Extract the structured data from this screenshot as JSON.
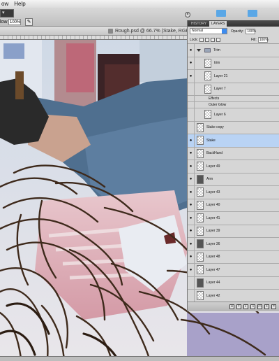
{
  "menubar": {
    "items": [
      "ow",
      "Help"
    ]
  },
  "options": {
    "flow_label": "low",
    "flow_value": "100%",
    "tool_preset": ""
  },
  "document": {
    "title": "Rough.psd @ 66.7% (Stake, RGB/8)"
  },
  "panel": {
    "tabs": [
      "HISTORY",
      "LAYERS"
    ],
    "blend_mode": "Normal",
    "opacity_label": "Opacity:",
    "opacity_value": "100%",
    "lock_label": "Lock:",
    "fill_label": "Fill:",
    "fill_value": "100%",
    "layers": [
      {
        "name": "Trim",
        "type": "group",
        "visible": true
      },
      {
        "name": "trim",
        "type": "layer",
        "visible": true,
        "indent": 1
      },
      {
        "name": "Layer 21",
        "type": "layer",
        "visible": true,
        "indent": 1
      },
      {
        "name": "Layer 7",
        "type": "layer",
        "visible": false,
        "indent": 1
      },
      {
        "name": "Effects",
        "type": "effects",
        "visible": false
      },
      {
        "name": "Outer Glow",
        "type": "effect",
        "visible": false
      },
      {
        "name": "Layer 6",
        "type": "layer",
        "visible": false,
        "indent": 1
      },
      {
        "name": "Stake copy",
        "type": "layer",
        "visible": false
      },
      {
        "name": "Stake",
        "type": "layer",
        "visible": true,
        "selected": true
      },
      {
        "name": "BackHand",
        "type": "layer",
        "visible": true
      },
      {
        "name": "Layer 49",
        "type": "layer",
        "visible": true
      },
      {
        "name": "Arm",
        "type": "layer",
        "visible": true,
        "art": true
      },
      {
        "name": "Layer 43",
        "type": "layer",
        "visible": true
      },
      {
        "name": "Layer 40",
        "type": "layer",
        "visible": true
      },
      {
        "name": "Layer 41",
        "type": "layer",
        "visible": true
      },
      {
        "name": "Layer 39",
        "type": "layer",
        "visible": true
      },
      {
        "name": "Layer 36",
        "type": "layer",
        "visible": true,
        "art": true
      },
      {
        "name": "Layer 48",
        "type": "layer",
        "visible": true
      },
      {
        "name": "Layer 47",
        "type": "layer",
        "visible": true
      },
      {
        "name": "Layer 44",
        "type": "layer",
        "visible": false,
        "art": true
      },
      {
        "name": "Layer 42",
        "type": "layer",
        "visible": false
      }
    ],
    "footer_icons": [
      "link-icon",
      "fx-icon",
      "mask-icon",
      "adjustment-icon",
      "folder-icon",
      "new-layer-icon",
      "trash-icon"
    ]
  },
  "colors": {
    "selected_layer": "#b9d3f4",
    "accent": "#3d8cf0",
    "desktop_red": "#b30f1a"
  }
}
